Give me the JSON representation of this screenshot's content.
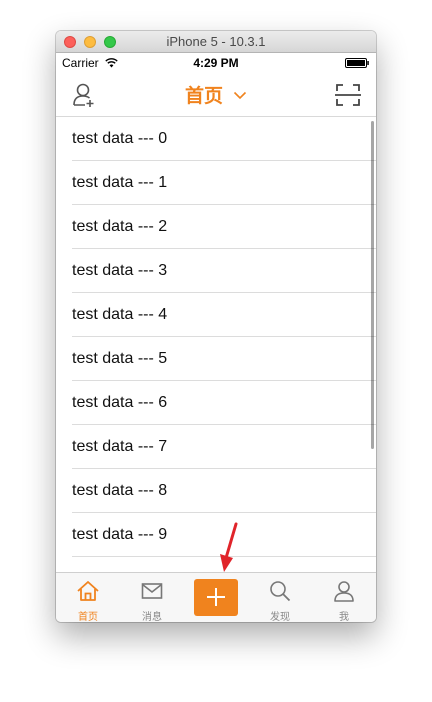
{
  "window": {
    "title": "iPhone 5 - 10.3.1"
  },
  "status_bar": {
    "carrier": "Carrier",
    "time": "4:29 PM"
  },
  "nav_bar": {
    "title": "首页",
    "left_icon": "add-friend-icon",
    "right_icon": "scan-icon",
    "title_icon": "chevron-down-icon"
  },
  "list": {
    "items": [
      "test data --- 0",
      "test data --- 1",
      "test data --- 2",
      "test data --- 3",
      "test data --- 4",
      "test data --- 5",
      "test data --- 6",
      "test data --- 7",
      "test data --- 8",
      "test data --- 9"
    ]
  },
  "tab_bar": {
    "tabs": [
      {
        "label": "首页",
        "icon": "home-icon",
        "active": true
      },
      {
        "label": "消息",
        "icon": "message-icon",
        "active": false
      },
      {
        "label": "",
        "icon": "plus-icon",
        "active": false
      },
      {
        "label": "发现",
        "icon": "search-icon",
        "active": false
      },
      {
        "label": "我",
        "icon": "profile-icon",
        "active": false
      }
    ]
  },
  "colors": {
    "accent": "#f0831e",
    "tab_inactive": "#888888",
    "annotation_arrow": "#e0242a"
  }
}
